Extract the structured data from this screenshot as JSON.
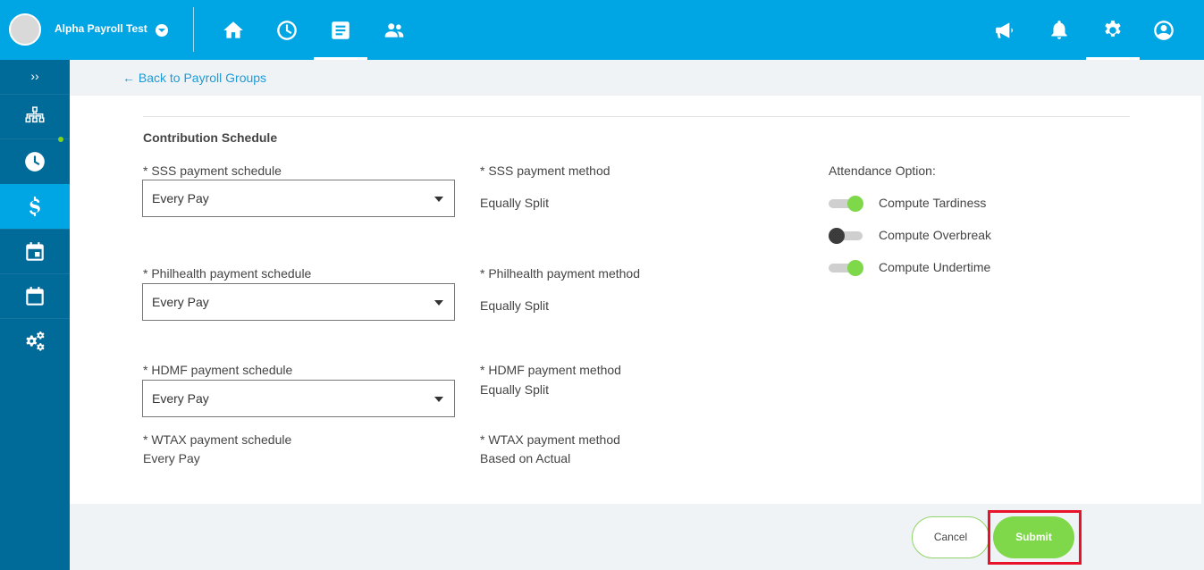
{
  "header": {
    "company_name": "Alpha Payroll Test",
    "nav": [
      {
        "icon": "home-icon"
      },
      {
        "icon": "clock-icon"
      },
      {
        "icon": "document-icon",
        "active": true
      },
      {
        "icon": "people-icon"
      }
    ],
    "right_icons": [
      "megaphone-icon",
      "bell-icon",
      "gear-icon",
      "user-circle-icon"
    ]
  },
  "sidebar": {
    "toggle_label": "››",
    "items": [
      {
        "icon": "org-chart-icon"
      },
      {
        "icon": "clock-icon"
      },
      {
        "icon": "dollar-icon",
        "active": true
      },
      {
        "icon": "calendar-event-icon"
      },
      {
        "icon": "calendar-icon"
      },
      {
        "icon": "gears-icon"
      }
    ]
  },
  "back_link": "← Back to Payroll Groups",
  "section_title": "Contribution Schedule",
  "sss": {
    "schedule_label": "* SSS payment schedule",
    "schedule_value": "Every Pay",
    "method_label": "* SSS payment method",
    "method_value": "Equally Split"
  },
  "philhealth": {
    "schedule_label": "* Philhealth payment schedule",
    "schedule_value": "Every Pay",
    "method_label": "* Philhealth payment method",
    "method_value": "Equally Split"
  },
  "hdmf": {
    "schedule_label": "* HDMF payment schedule",
    "schedule_value": "Every Pay",
    "method_label": "* HDMF payment method",
    "method_value": "Equally Split"
  },
  "wtax": {
    "schedule_label": "* WTAX payment schedule",
    "schedule_value": "Every Pay",
    "method_label": "* WTAX payment method",
    "method_value": "Based on Actual"
  },
  "attendance": {
    "title": "Attendance Option:",
    "options": [
      {
        "label": "Compute Tardiness",
        "on": true
      },
      {
        "label": "Compute Overbreak",
        "on": false
      },
      {
        "label": "Compute Undertime",
        "on": true
      }
    ]
  },
  "buttons": {
    "cancel": "Cancel",
    "submit": "Submit"
  },
  "colors": {
    "topbar": "#00a5e3",
    "sidebar": "#006a98",
    "accent_green": "#7ed84a",
    "highlight_red": "#e8122b"
  }
}
